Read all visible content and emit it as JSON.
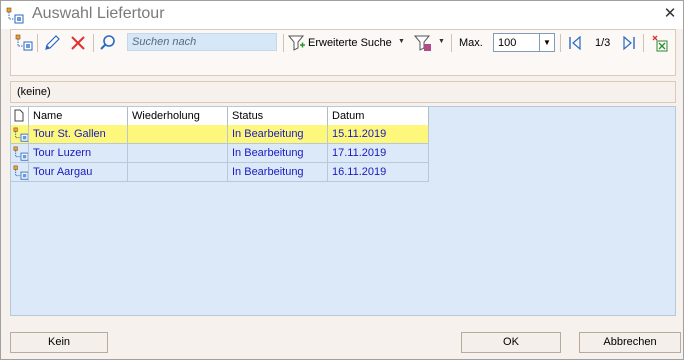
{
  "window": {
    "title": "Auswahl Liefertour"
  },
  "toolbar": {
    "search_placeholder": "Suchen nach",
    "extended_search_label": "Erweiterte Suche",
    "max_label": "Max.",
    "max_value": "100",
    "page_indicator": "1/3"
  },
  "filter": {
    "text": "(keine)"
  },
  "grid": {
    "columns": [
      "Name",
      "Wiederholung",
      "Status",
      "Datum"
    ],
    "rows": [
      {
        "name": "Tour St. Gallen",
        "repeat": "",
        "status": "In Bearbeitung",
        "date": "15.11.2019",
        "selected": true
      },
      {
        "name": "Tour Luzern",
        "repeat": "",
        "status": "In Bearbeitung",
        "date": "17.11.2019",
        "selected": false
      },
      {
        "name": "Tour Aargau",
        "repeat": "",
        "status": "In Bearbeitung",
        "date": "16.11.2019",
        "selected": false
      }
    ]
  },
  "buttons": {
    "none": "Kein",
    "ok": "OK",
    "cancel": "Abbrechen"
  },
  "colors": {
    "selected_row": "#fdf87c",
    "grid_background": "#dce9f8",
    "link_text": "#1a1ac0",
    "search_background": "#d6e7f7"
  }
}
